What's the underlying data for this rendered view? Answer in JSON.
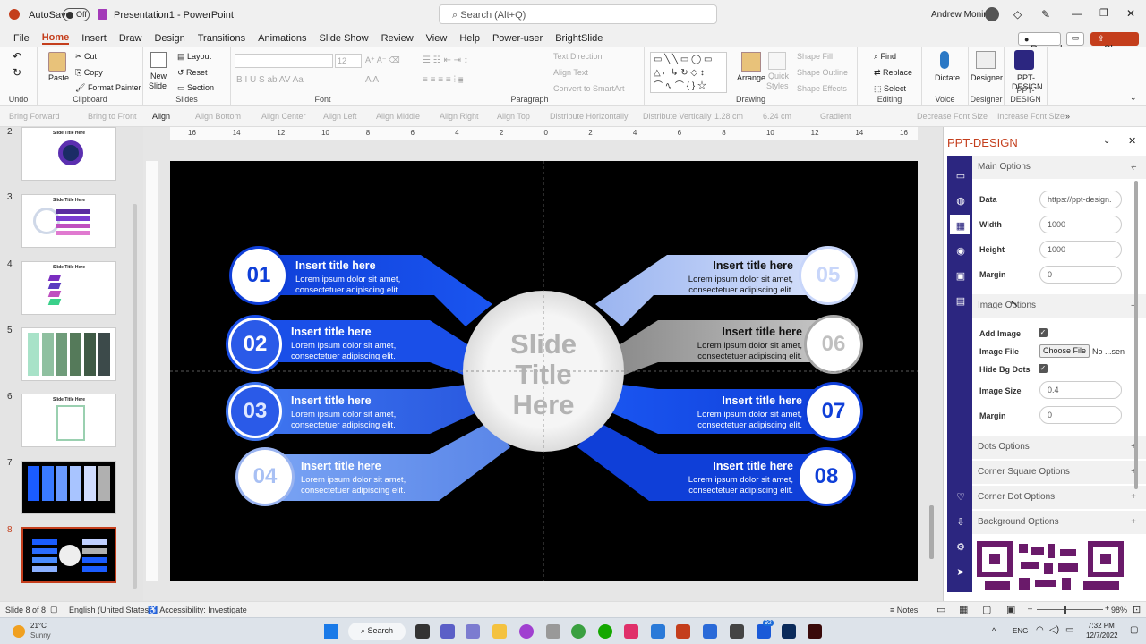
{
  "titlebar": {
    "autosave_label": "AutoSave",
    "autosave_state": "Off",
    "doc_title": "Presentation1",
    "app_name": "PowerPoint",
    "search_placeholder": "Search (Alt+Q)",
    "user": "Andrew Monir"
  },
  "tabs": [
    "File",
    "Home",
    "Insert",
    "Draw",
    "Design",
    "Transitions",
    "Animations",
    "Slide Show",
    "Review",
    "View",
    "Help",
    "Power-user",
    "BrightSlide"
  ],
  "record_label": "Record",
  "share_label": "Share",
  "ribbon": {
    "undo_label": "Undo",
    "clipboard": {
      "label": "Clipboard",
      "paste": "Paste",
      "cut": "Cut",
      "copy": "Copy",
      "format_painter": "Format Painter"
    },
    "slides": {
      "label": "Slides",
      "new_slide": "New",
      "new_slide2": "Slide",
      "layout": "Layout",
      "reset": "Reset",
      "section": "Section"
    },
    "font": {
      "label": "Font",
      "size": "12"
    },
    "paragraph": {
      "label": "Paragraph",
      "text_direction": "Text Direction",
      "align_text": "Align Text",
      "convert": "Convert to SmartArt"
    },
    "drawing": {
      "label": "Drawing",
      "arrange": "Arrange",
      "quick_styles": "Quick",
      "quick_styles2": "Styles",
      "shape_fill": "Shape Fill",
      "shape_outline": "Shape Outline",
      "shape_effects": "Shape Effects"
    },
    "editing": {
      "label": "Editing",
      "find": "Find",
      "replace": "Replace",
      "select": "Select"
    },
    "voice": {
      "label": "Voice",
      "dictate": "Dictate"
    },
    "designer": {
      "label": "Designer",
      "designer": "Designer"
    },
    "pptdesign": {
      "label": "PPT-DESIGN",
      "btn": "PPT-",
      "btn2": "DESIGN"
    }
  },
  "drawtoolbar": [
    "Bring Forward",
    "Bring to Front",
    "Align",
    "Align Bottom",
    "Align Center",
    "Align Left",
    "Align Middle",
    "Align Right",
    "Align Top",
    "Distribute Horizontally",
    "Distribute Vertically",
    "1.28 cm",
    "6.24 cm",
    "Gradient",
    "Decrease Font Size",
    "Increase Font Size"
  ],
  "thumbnails": [
    {
      "num": "2",
      "title": "Slide Title Here"
    },
    {
      "num": "3",
      "title": "Slide Title Here"
    },
    {
      "num": "4",
      "title": "Slide Title Here"
    },
    {
      "num": "5",
      "title": ""
    },
    {
      "num": "6",
      "title": "Slide Title Here"
    },
    {
      "num": "7",
      "title": ""
    },
    {
      "num": "8",
      "title": ""
    }
  ],
  "ruler_h": [
    "16",
    "14",
    "12",
    "10",
    "8",
    "6",
    "4",
    "2",
    "0",
    "2",
    "4",
    "6",
    "8",
    "10",
    "12",
    "14",
    "16"
  ],
  "slide": {
    "center": {
      "line1": "Slide",
      "line2": "Title",
      "line3": "Here"
    },
    "items": [
      {
        "num": "01",
        "title": "Insert title here",
        "body1": "Lorem ipsum dolor sit amet,",
        "body2": "consectetuer adipiscing elit."
      },
      {
        "num": "02",
        "title": "Insert title here",
        "body1": "Lorem ipsum dolor sit amet,",
        "body2": "consectetuer adipiscing elit."
      },
      {
        "num": "03",
        "title": "Insert title here",
        "body1": "Lorem ipsum dolor sit amet,",
        "body2": "consectetuer adipiscing elit."
      },
      {
        "num": "04",
        "title": "Insert title here",
        "body1": "Lorem ipsum dolor sit amet,",
        "body2": "consectetuer adipiscing elit."
      },
      {
        "num": "05",
        "title": "Insert title here",
        "body1": "Lorem ipsum dolor sit amet,",
        "body2": "consectetuer adipiscing elit."
      },
      {
        "num": "06",
        "title": "Insert title here",
        "body1": "Lorem ipsum dolor sit amet,",
        "body2": "consectetuer adipiscing elit."
      },
      {
        "num": "07",
        "title": "Insert title here",
        "body1": "Lorem ipsum dolor sit amet,",
        "body2": "consectetuer adipiscing elit."
      },
      {
        "num": "08",
        "title": "Insert title here",
        "body1": "Lorem ipsum dolor sit amet,",
        "body2": "consectetuer adipiscing elit."
      }
    ]
  },
  "panel": {
    "title": "PPT-DESIGN",
    "main_options": "Main Options",
    "data_label": "Data",
    "data_value": "https://ppt-design.",
    "width_label": "Width",
    "width_value": "1000",
    "height_label": "Height",
    "height_value": "1000",
    "margin_label": "Margin",
    "margin_value": "0",
    "image_options": "Image Options",
    "add_image": "Add Image",
    "image_file": "Image File",
    "choose_file": "Choose File",
    "no_file": "No ...sen",
    "hide_bg": "Hide Bg Dots",
    "image_size": "Image Size",
    "image_size_value": "0.4",
    "img_margin": "Margin",
    "img_margin_value": "0",
    "dots_options": "Dots Options",
    "corner_square": "Corner Square Options",
    "corner_dot": "Corner Dot Options",
    "background": "Background Options"
  },
  "status": {
    "slide": "Slide 8 of 8",
    "language": "English (United States)",
    "accessibility": "Accessibility: Investigate",
    "notes": "Notes",
    "zoom": "98%"
  },
  "taskbar": {
    "weather_temp": "21°C",
    "weather_desc": "Sunny",
    "search": "Search",
    "lang": "ENG",
    "time": "7:32 PM",
    "date": "12/7/2022",
    "badge": "92"
  }
}
